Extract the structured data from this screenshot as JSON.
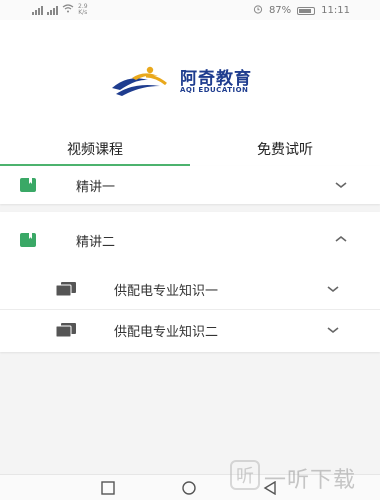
{
  "status_bar": {
    "carrier_icons": "signal-icon",
    "speed_value": "2.9",
    "speed_unit": "K/s",
    "battery": "87%",
    "time": "11:11"
  },
  "brand": {
    "name_cn": "阿奇教育",
    "name_en": "AQI EDUCATION"
  },
  "tabs": [
    {
      "label": "视频课程",
      "active": true
    },
    {
      "label": "免费试听",
      "active": false
    }
  ],
  "sections": [
    {
      "label": "精讲一",
      "expanded": false,
      "items": []
    },
    {
      "label": "精讲二",
      "expanded": true,
      "items": [
        {
          "label": "供配电专业知识一"
        },
        {
          "label": "供配电专业知识二"
        }
      ]
    }
  ],
  "watermark": {
    "badge": "听",
    "text": "一听下载"
  },
  "colors": {
    "accent": "#4cb36e",
    "icon_green": "#3aa866",
    "brand_blue": "#1f3d8f",
    "brand_gold": "#e9a81c"
  }
}
